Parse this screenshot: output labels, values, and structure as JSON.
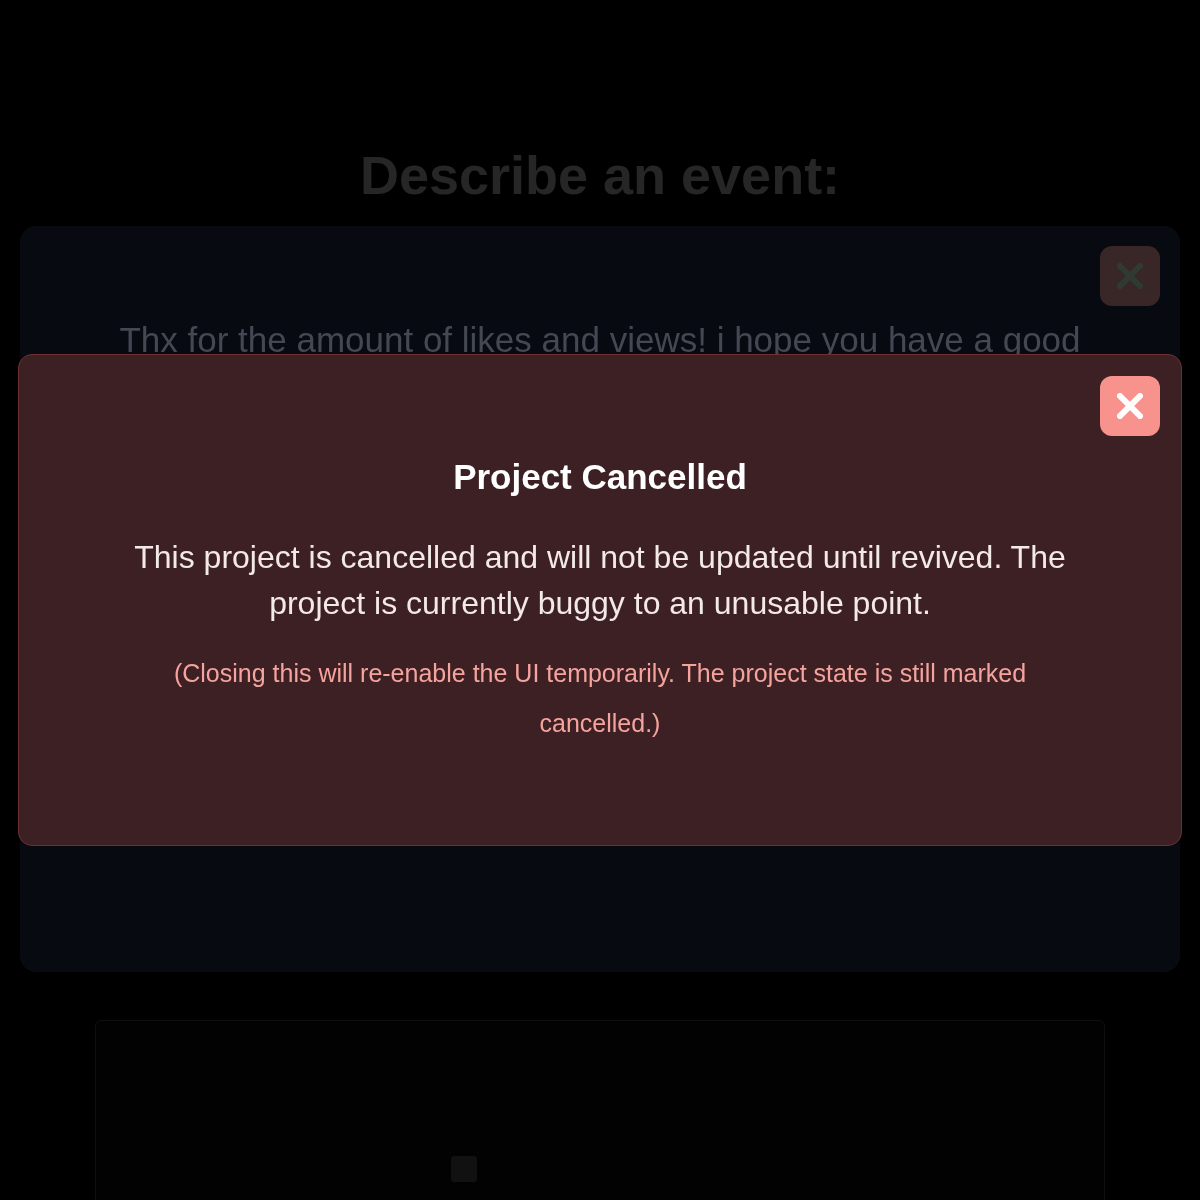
{
  "page": {
    "heading": "Describe an event:"
  },
  "event_card": {
    "text": "Thx for the amount of likes and views! i hope you have a good"
  },
  "form": {
    "checkbox": {
      "checked": false
    }
  },
  "modal": {
    "title": "Project Cancelled",
    "message": "This project is cancelled and will not be updated until revived. The project is currently buggy to an unusable point.",
    "note": "(Closing this will re-enable the UI temporarily. The project state is still marked cancelled.)"
  }
}
